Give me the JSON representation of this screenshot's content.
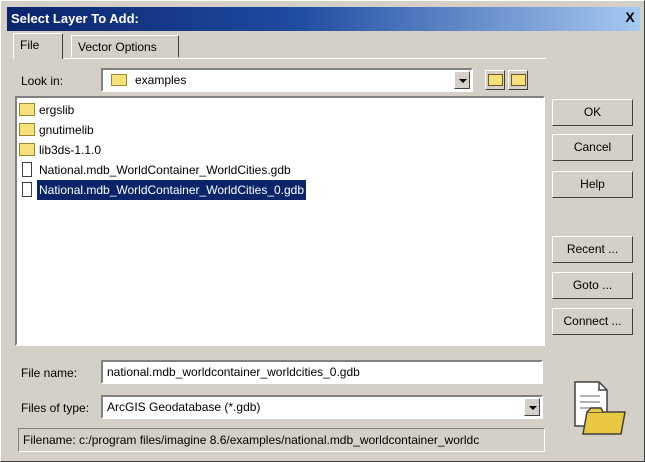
{
  "window": {
    "title": "Select Layer To Add:",
    "close_label": "X"
  },
  "tabs": [
    {
      "label": "File"
    },
    {
      "label": "Vector Options"
    }
  ],
  "look_in": {
    "label": "Look in:",
    "value": "examples"
  },
  "files": [
    {
      "name": "ergslib",
      "type": "folder"
    },
    {
      "name": "gnutimelib",
      "type": "folder"
    },
    {
      "name": "lib3ds-1.1.0",
      "type": "folder"
    },
    {
      "name": "National.mdb_WorldContainer_WorldCities.gdb",
      "type": "file"
    },
    {
      "name": "National.mdb_WorldContainer_WorldCities_0.gdb",
      "type": "file",
      "selected": true
    }
  ],
  "buttons": {
    "ok": "OK",
    "cancel": "Cancel",
    "help": "Help",
    "recent": "Recent ...",
    "goto": "Goto ...",
    "connect": "Connect ..."
  },
  "file_name": {
    "label": "File name:",
    "value": "national.mdb_worldcontainer_worldcities_0.gdb"
  },
  "files_of_type": {
    "label": "Files of type:",
    "value": "ArcGIS Geodatabase (*.gdb)"
  },
  "status": {
    "text": "Filename: c:/program files/imagine 8.6/examples/national.mdb_worldcontainer_worldc"
  }
}
